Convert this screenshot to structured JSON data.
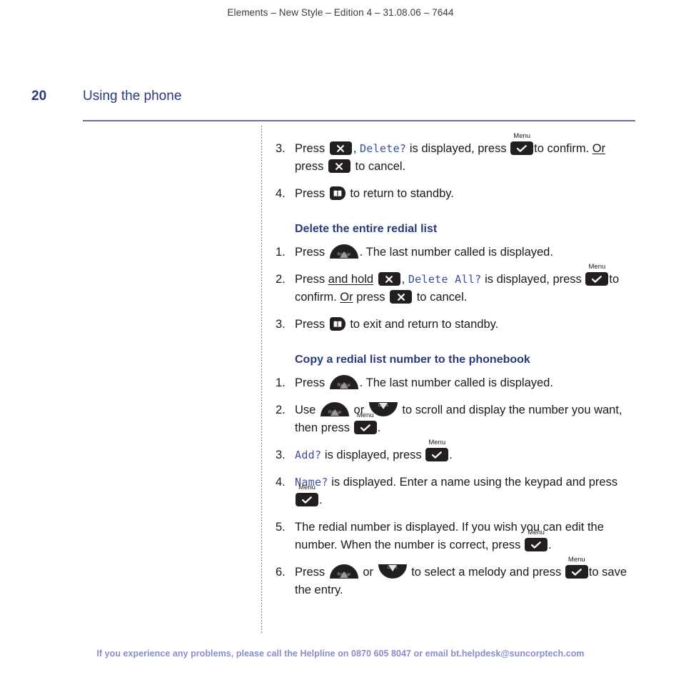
{
  "header": {
    "running_head": "Elements – New Style – Edition 4 – 31.08.06 – 7644"
  },
  "page": {
    "folio": "20",
    "chapter_title": "Using the phone"
  },
  "colors": {
    "heading_blue": "#2a3a7c",
    "lcd_blue": "#3a4fa0",
    "rule_purple": "#6a6aa8",
    "footer_purple": "#8a8ad0",
    "key_dark": "#231f20"
  },
  "icons": {
    "cancel_key": "cancel-x-key-icon",
    "menu_key": "menu-check-key-icon",
    "menu_key_caption": "Menu",
    "standby_key": "standby-phonebook-key-icon",
    "redial_key": "redial-up-key-icon",
    "redial_key_label": "Redial",
    "calls_key": "calls-down-key-icon",
    "calls_key_label": "Calls"
  },
  "content": {
    "block1": {
      "items": [
        {
          "num": "3.",
          "seg": {
            "a": "Press ",
            "b": ", ",
            "lcd": "Delete?",
            "c": " is displayed, press ",
            "d": "to confirm. ",
            "or": "Or",
            "e": " press ",
            "f": " to cancel."
          }
        },
        {
          "num": "4.",
          "seg": {
            "a": "Press ",
            "b": " to return to standby."
          }
        }
      ]
    },
    "section1": {
      "heading": "Delete the entire redial list",
      "items": [
        {
          "num": "1.",
          "seg": {
            "a": "Press ",
            "b": ". The last number called is displayed."
          }
        },
        {
          "num": "2.",
          "seg": {
            "a": "Press ",
            "hold": "and hold",
            "b": " ",
            "lcd": "Delete All?",
            "c": " is displayed, press ",
            "d": "to confirm. ",
            "or": "Or",
            "e": " press ",
            "f": " to cancel.",
            "comma": ", "
          }
        },
        {
          "num": "3.",
          "seg": {
            "a": "Press ",
            "b": " to exit and return to standby."
          }
        }
      ]
    },
    "section2": {
      "heading": "Copy a redial list number to the phonebook",
      "items": [
        {
          "num": "1.",
          "seg": {
            "a": "Press ",
            "b": ". The last number called is displayed."
          }
        },
        {
          "num": "2.",
          "seg": {
            "a": "Use ",
            "b": " or ",
            "c": " to scroll and display the number you want, then press ",
            "d": "."
          }
        },
        {
          "num": "3.",
          "seg": {
            "lcd": "Add?",
            "a": " is displayed, press ",
            "b": "."
          }
        },
        {
          "num": "4.",
          "seg": {
            "lcd": "Name?",
            "a": " is displayed. Enter a name using the keypad and press ",
            "b": "."
          }
        },
        {
          "num": "5.",
          "seg": {
            "a": "The redial number is displayed. If you wish you can edit the number. When the number is correct, press ",
            "b": "."
          }
        },
        {
          "num": "6.",
          "seg": {
            "a": "Press ",
            "b": " or ",
            "c": " to select a melody and press ",
            "d": "to save the entry."
          }
        }
      ]
    }
  },
  "footer": {
    "text": "If you experience any problems, please call the Helpline on 0870 605 8047 or email bt.helpdesk@suncorptech.com"
  }
}
